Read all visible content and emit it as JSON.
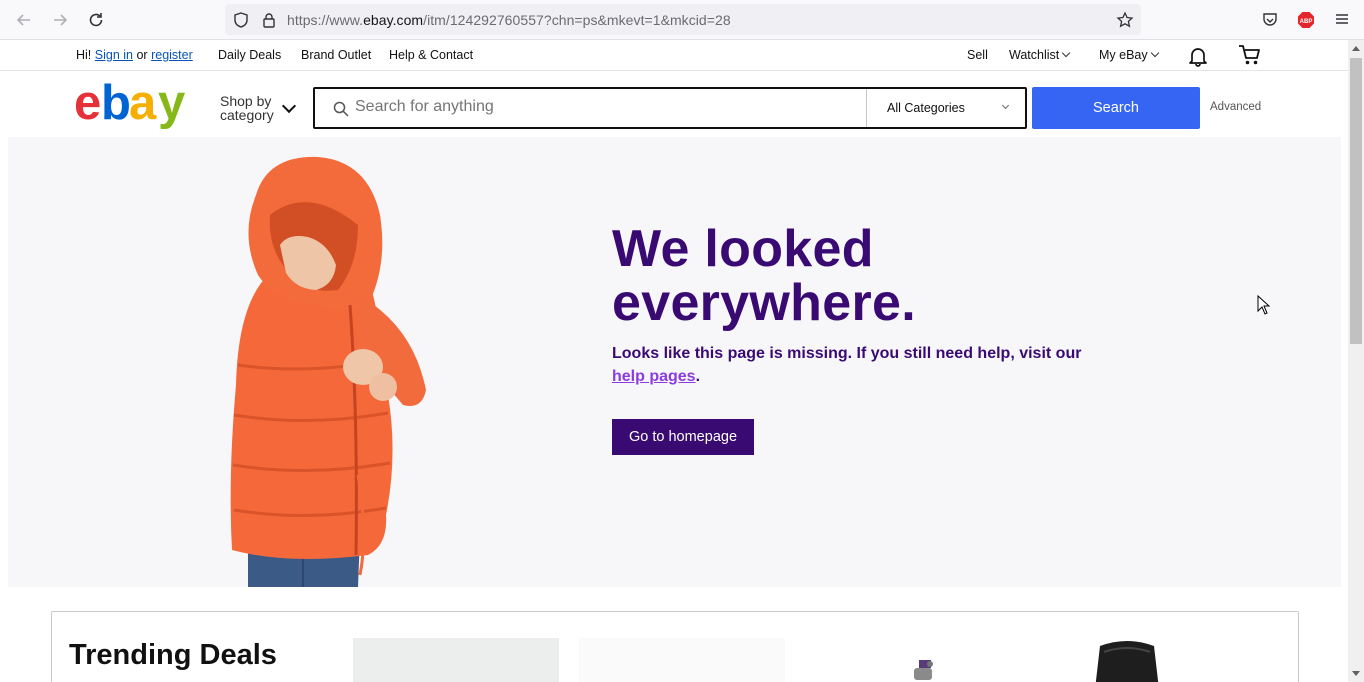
{
  "browser": {
    "url_prefix": "https://www.",
    "url_host": "ebay.com",
    "url_path": "/itm/124292760557?chn=ps&mkevt=1&mkcid=28"
  },
  "top_nav": {
    "greeting": "Hi!",
    "sign_in": "Sign in",
    "or": "or",
    "register": "register",
    "daily_deals": "Daily Deals",
    "brand_outlet": "Brand Outlet",
    "help_contact": "Help & Contact",
    "sell": "Sell",
    "watchlist": "Watchlist",
    "my_ebay": "My eBay"
  },
  "header": {
    "logo_letters": [
      "e",
      "b",
      "a",
      "y"
    ],
    "logo_colors": [
      "#e53238",
      "#0064d2",
      "#f5af02",
      "#86b817"
    ],
    "shop_by_line1": "Shop by",
    "shop_by_line2": "category",
    "search_placeholder": "Search for anything",
    "category_selected": "All Categories",
    "search_button": "Search",
    "advanced": "Advanced"
  },
  "hero": {
    "title_line1": "We looked",
    "title_line2": "everywhere.",
    "message": "Looks like this page is missing. If you still need help, visit our",
    "help_link": "help pages",
    "period": ".",
    "button": "Go to homepage",
    "colors": {
      "primary": "#3a0a73",
      "link": "#8a3ce0",
      "background": "#f7f7fa"
    }
  },
  "trending": {
    "title": "Trending Deals"
  },
  "colors": {
    "search_button": "#3665f3",
    "link": "#0654ba"
  }
}
